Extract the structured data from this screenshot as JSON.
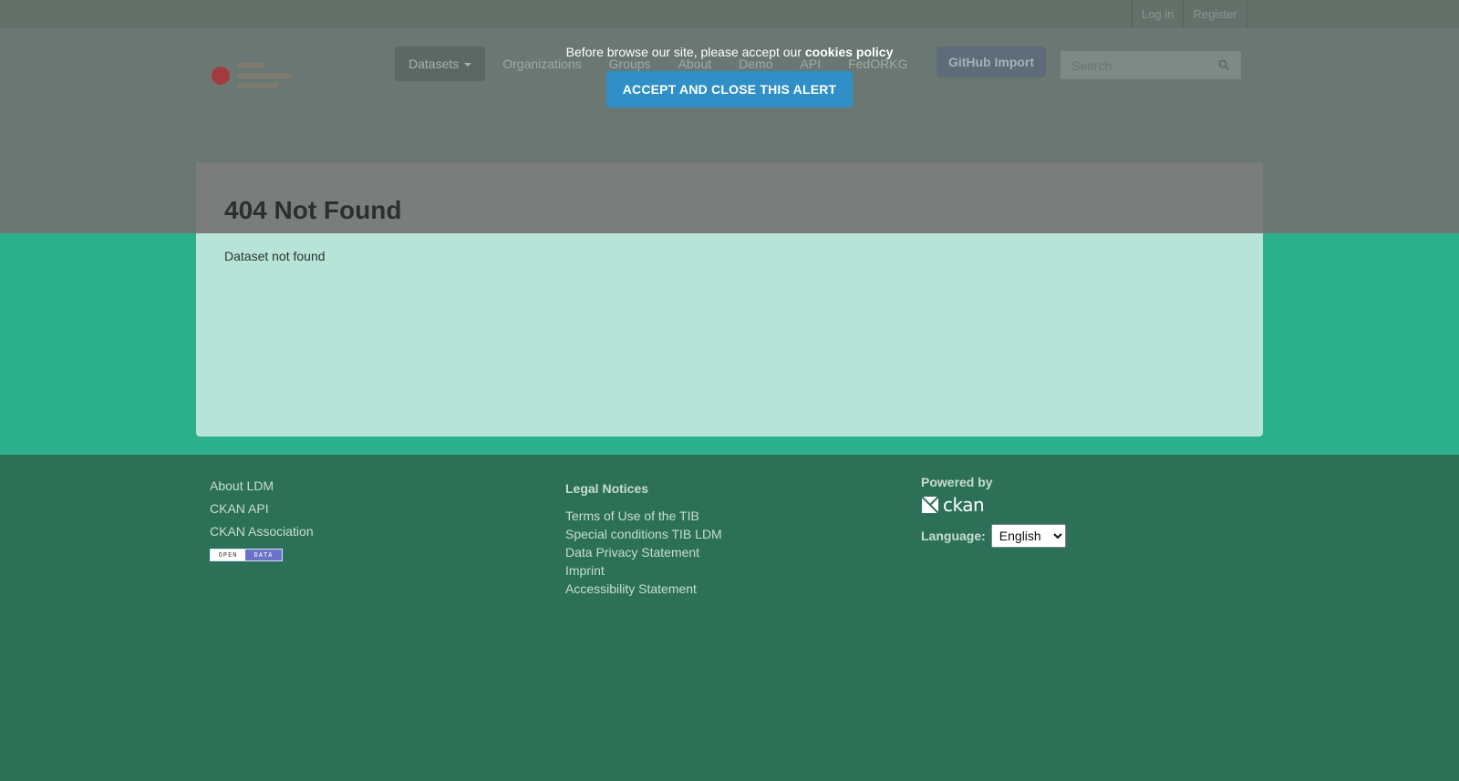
{
  "account": {
    "login_label": "Log in",
    "register_label": "Register"
  },
  "nav": {
    "items": [
      {
        "label": "Datasets"
      },
      {
        "label": "Organizations"
      },
      {
        "label": "Groups"
      },
      {
        "label": "About"
      },
      {
        "label": "Demo"
      },
      {
        "label": "API"
      },
      {
        "label": "FedORKG"
      }
    ],
    "github_label": "GitHub Import",
    "search_placeholder": "Search"
  },
  "cookie": {
    "message": "Before browse our site, please accept our ",
    "policy_link": "cookies policy",
    "accept_label": "ACCEPT AND CLOSE THIS ALERT"
  },
  "main": {
    "title": "404 Not Found",
    "message": "Dataset not found"
  },
  "footer": {
    "links": [
      "About LDM",
      "CKAN API",
      "CKAN Association"
    ],
    "open_data_badge": {
      "left": "OPEN",
      "right": "DATA"
    },
    "legal_title": "Legal Notices",
    "legal_links": [
      "Terms of Use of the TIB",
      "Special conditions TIB LDM",
      "Data Privacy Statement",
      "Imprint",
      "Accessibility Statement"
    ],
    "powered_by": "Powered by",
    "ckan_word": "ckan",
    "language_label": "Language:",
    "language_selected": "English"
  },
  "colors": {
    "overlay": "#6a7772",
    "wrapper": "#2cb08b",
    "footer": "#2c7157",
    "accept_button": "#2f8fc6"
  }
}
